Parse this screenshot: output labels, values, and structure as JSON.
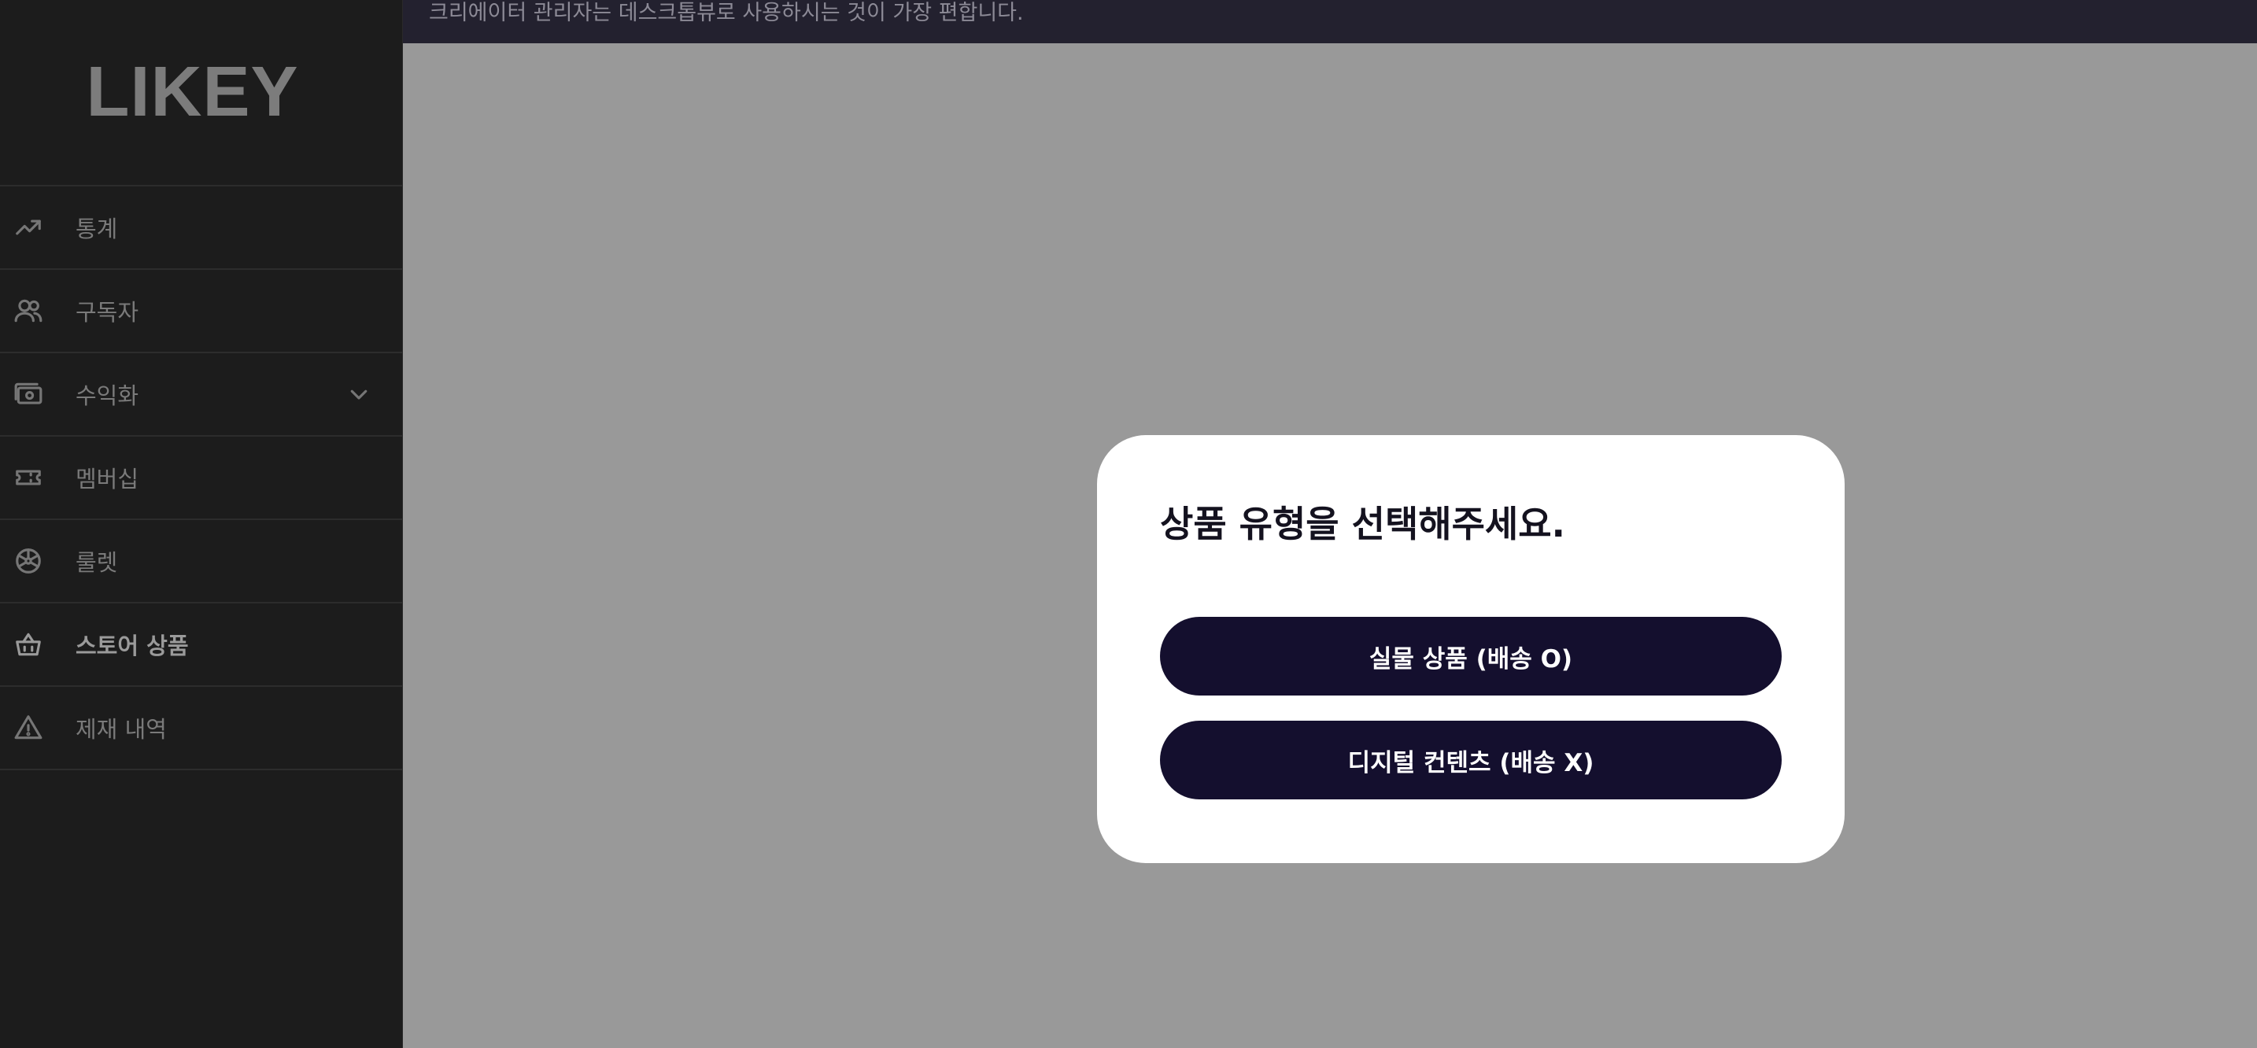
{
  "banner": {
    "text": "크리에이터 관리자는 데스크톱뷰로 사용하시는 것이 가장 편합니다."
  },
  "sidebar": {
    "logo": "LIKEY",
    "items": [
      {
        "label": "통계",
        "icon": "trending-up-icon"
      },
      {
        "label": "구독자",
        "icon": "users-icon"
      },
      {
        "label": "수익화",
        "icon": "money-icon",
        "expandable": true
      },
      {
        "label": "멤버십",
        "icon": "ticket-icon"
      },
      {
        "label": "룰렛",
        "icon": "roulette-icon"
      },
      {
        "label": "스토어 상품",
        "icon": "basket-icon",
        "active": true
      },
      {
        "label": "제재 내역",
        "icon": "warning-icon"
      }
    ]
  },
  "modal": {
    "title": "상품 유형을 선택해주세요.",
    "physical_button": "실물 상품 (배송 O)",
    "digital_button": "디지털 컨텐츠 (배송 X)"
  },
  "colors": {
    "sidebar_bg": "#1c1c1c",
    "banner_bg": "#23212f",
    "overlay_bg": "#999999",
    "button_bg": "#140f2e"
  }
}
